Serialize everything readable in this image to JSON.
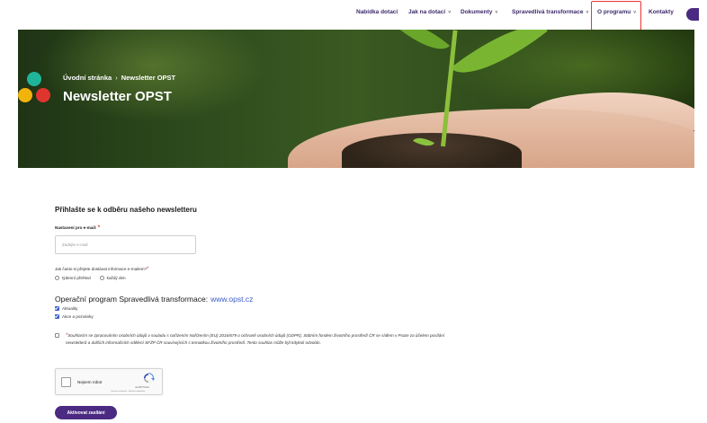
{
  "nav": {
    "items": [
      {
        "label": "Nabídka dotací",
        "has_chevron": false
      },
      {
        "label": "Jak na dotaci",
        "has_chevron": true
      },
      {
        "label": "Dokumenty",
        "has_chevron": true
      },
      {
        "label": "Spravedlivá transformace",
        "has_chevron": true
      },
      {
        "label": "O programu",
        "has_chevron": true
      },
      {
        "label": "Kontakty",
        "has_chevron": false
      }
    ],
    "chevron_glyph": "˅"
  },
  "hero": {
    "breadcrumb_home": "Úvodní stránka",
    "breadcrumb_sep": "›",
    "breadcrumb_current": "Newsletter OPST",
    "title": "Newsletter OPST"
  },
  "form": {
    "section_title": "Přihlašte se k odběru našeho newsletteru",
    "email_label": "Nastavení pro e-mail:",
    "email_placeholder": "Zadejte e-mail",
    "email_value": "",
    "frequency_label": "Jak často si přejete dostávat informace e-mailem?",
    "frequency_options": [
      "týdenní přehled",
      "každý den"
    ],
    "required_mark": "*",
    "program_title": "Operační program Spravedlivá transformace:",
    "program_link": "www.opst.cz",
    "checkboxes": [
      {
        "label": "Aktuality",
        "checked": true
      },
      {
        "label": "Akce a pozvánky",
        "checked": true
      }
    ],
    "consent_text": "Souhlasím se zpracováním osobních údajů v souladu s nařízením Nařízením (EU) 2016/679 o ochraně osobních údajů (GDPR), Státním fondem životního prostředí ČR se sídlem v Praze za účelem posílání newsletterů a dalších informačních sdělení SFŽP ČR souvisejících s tematikou životního prostředí. Tento souhlas může být kdykoli odvolán.",
    "consent_checked": false,
    "captcha_label": "Nejsem robot",
    "captcha_brand": "reCAPTCHA",
    "captcha_terms": "Ochrana soukromí - Smluvní podmínky",
    "submit_label": "Aktivovat zasílání"
  },
  "colors": {
    "brand_purple": "#4b2a82",
    "link_blue": "#3b5bc9",
    "required_red": "#e0352e",
    "logo_teal": "#1fb59b",
    "logo_yellow": "#f2b30c",
    "logo_red": "#e0352e"
  }
}
